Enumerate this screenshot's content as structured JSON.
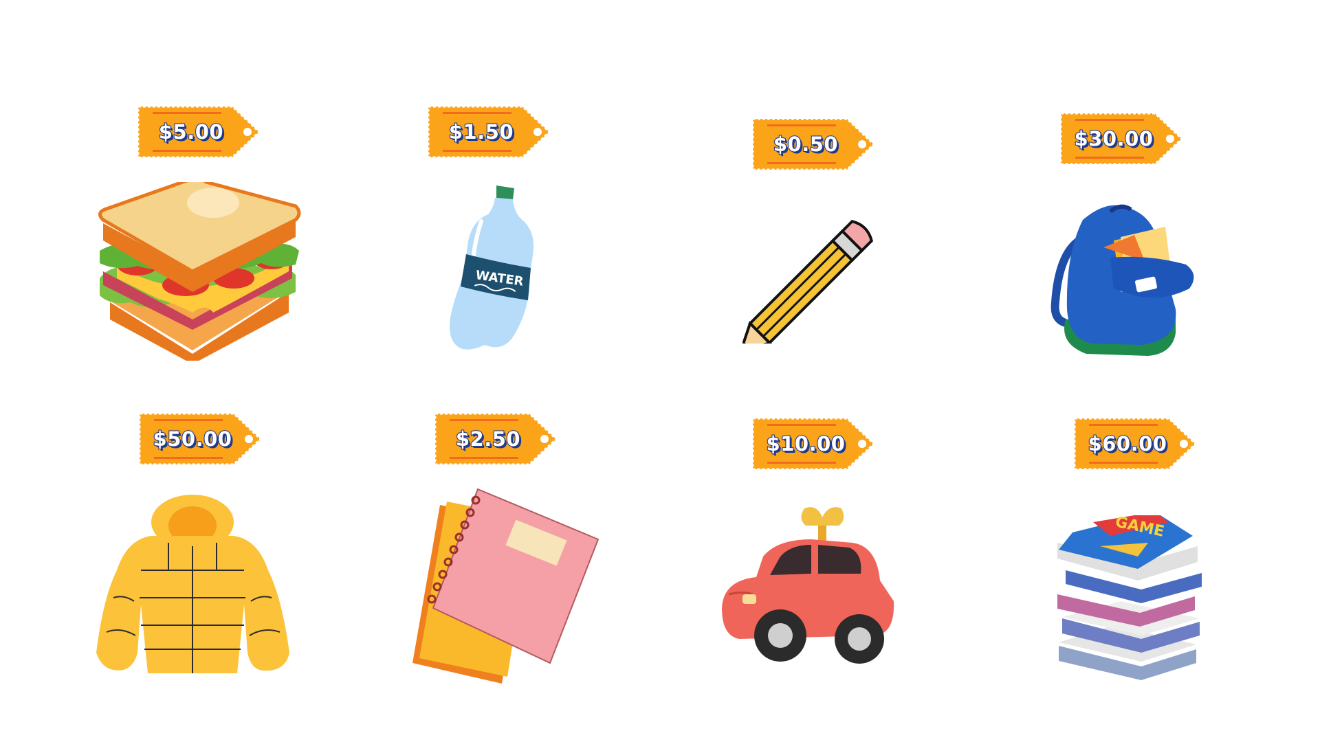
{
  "items": [
    {
      "name": "sandwich",
      "price": "$5.00"
    },
    {
      "name": "water-bottle",
      "price": "$1.50",
      "label": "WATER"
    },
    {
      "name": "pencil",
      "price": "$0.50"
    },
    {
      "name": "backpack",
      "price": "$30.00"
    },
    {
      "name": "puffer-jacket",
      "price": "$50.00"
    },
    {
      "name": "notebooks",
      "price": "$2.50"
    },
    {
      "name": "toy-car",
      "price": "$10.00"
    },
    {
      "name": "video-games",
      "price": "$60.00",
      "label": "GAME"
    }
  ],
  "colors": {
    "tag_fill": "#fba41a",
    "tag_stripe": "#f26a1b",
    "price_text": "#ffffff",
    "price_outline": "#1e3a8a"
  }
}
